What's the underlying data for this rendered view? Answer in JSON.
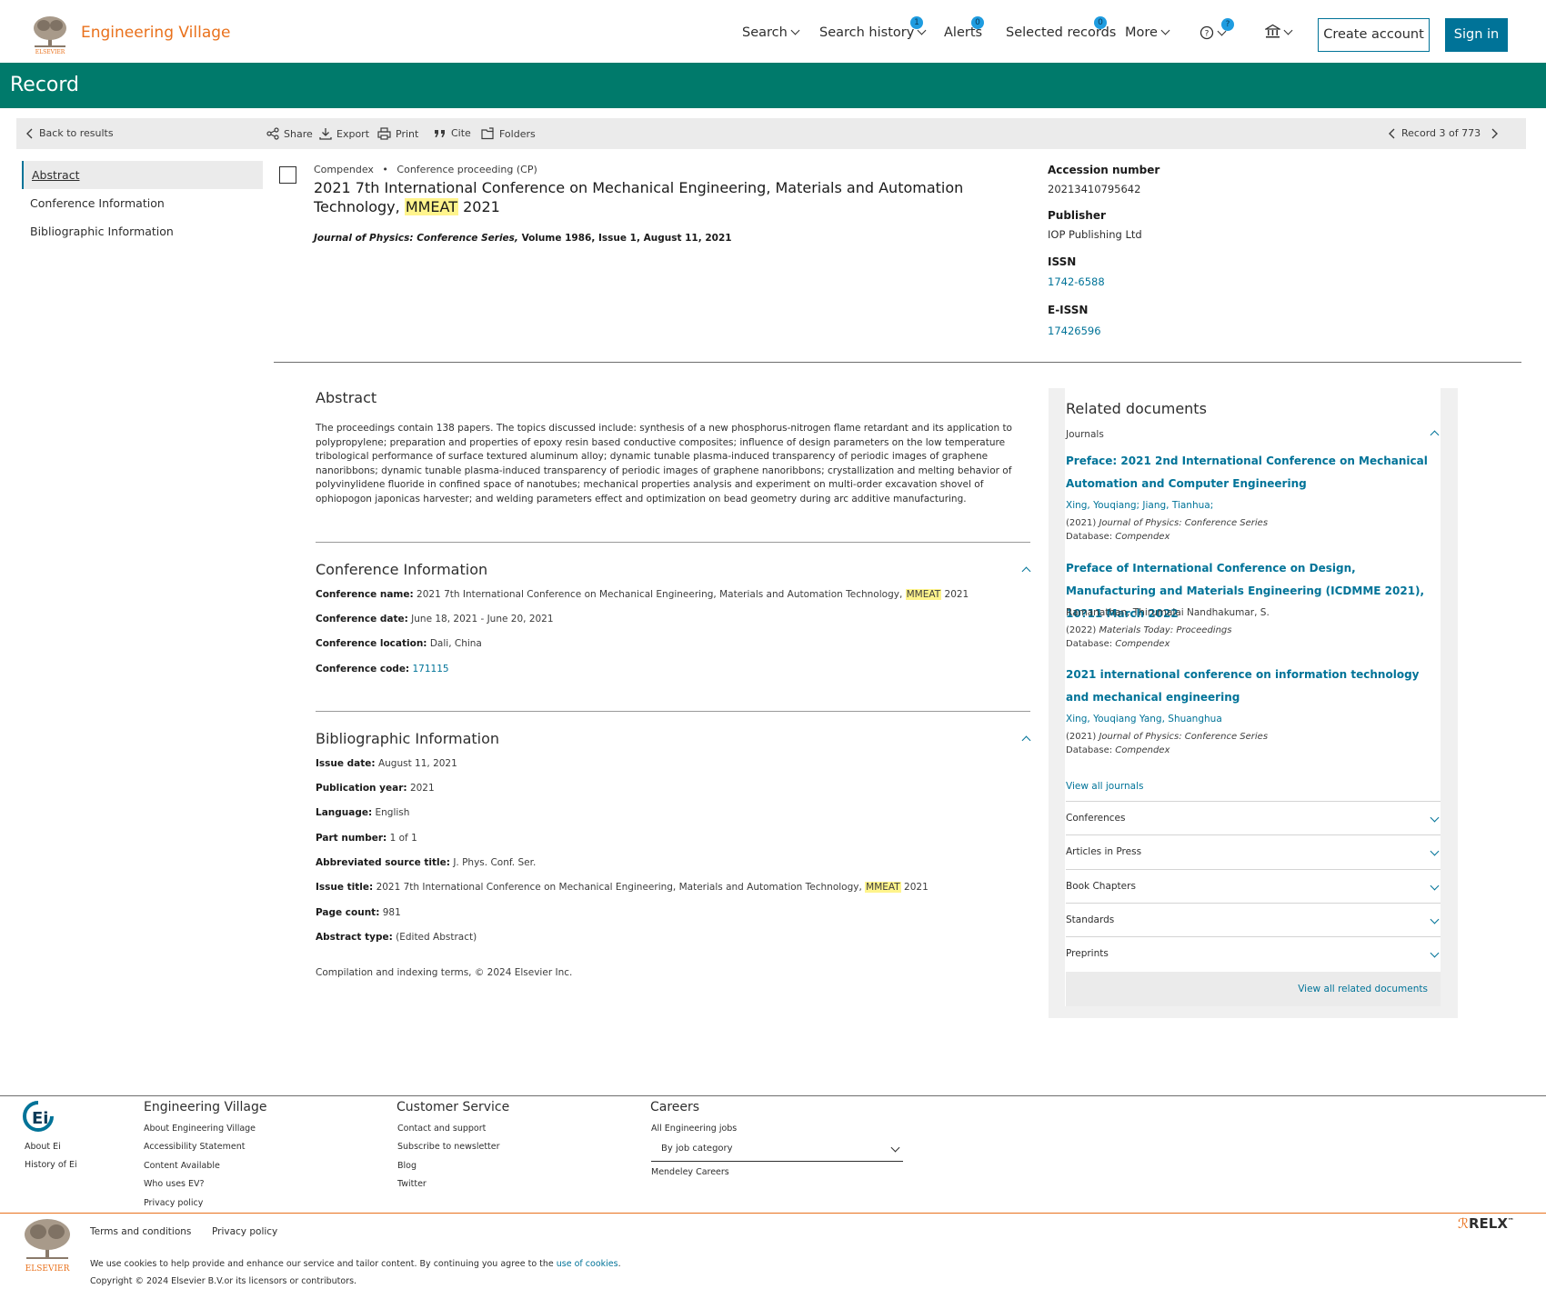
{
  "header": {
    "brand": "Engineering Village",
    "nav": [
      {
        "label": "Search",
        "badge": ""
      },
      {
        "label": "Search history",
        "badge": "1"
      },
      {
        "label": "Alerts",
        "badge": "0"
      },
      {
        "label": "Selected records",
        "badge": "0"
      },
      {
        "label": "More",
        "badge": ""
      }
    ],
    "help_badge": "?",
    "create_account": "Create account",
    "sign_in": "Sign in"
  },
  "band": {
    "title": "Record"
  },
  "toolbar": {
    "back": "Back to results",
    "share": "Share",
    "export": "Export",
    "print": "Print",
    "cite": "Cite",
    "folders": "Folders",
    "record_nav": "Record 3 of 773"
  },
  "left_nav": [
    "Abstract",
    "Conference Information",
    "Bibliographic Information"
  ],
  "record": {
    "database": "Compendex",
    "doc_type": "Conference proceeding (CP)",
    "title_pre": "2021 7th International Conference on Mechanical Engineering, Materials and Automation Technology,",
    "title_mark": "MMEAT",
    "title_post": "2021",
    "source_journal": "Journal of Physics: Conference Series,",
    "source_rest": "Volume 1986, Issue 1, August 11, 2021"
  },
  "right_meta": [
    {
      "label": "Accession number",
      "value": "20213410795642",
      "link": false
    },
    {
      "label": "Publisher",
      "value": "IOP Publishing Ltd",
      "link": false
    },
    {
      "label": "ISSN",
      "value": "1742-6588",
      "link": true
    },
    {
      "label": "E-ISSN",
      "value": "17426596",
      "link": true
    }
  ],
  "abstract": {
    "heading": "Abstract",
    "text": "The proceedings contain 138 papers. The topics discussed include: synthesis of a new phosphorus-nitrogen flame retardant and its application to polypropylene; preparation and properties of epoxy resin based conductive composites; influence of design parameters on the low temperature tribological performance of surface textured aluminum alloy; dynamic tunable plasma-induced transparency of periodic images of graphene nanoribbons; dynamic tunable plasma-induced transparency of periodic images of graphene nanoribbons; crystallization and melting behavior of polyvinylidene fluoride in confined space of nanotubes; mechanical properties analysis and experiment on multi-order excavation shovel of ophiopogon japonicas harvester; and welding parameters effect and optimization on bead geometry during arc additive manufacturing."
  },
  "conference": {
    "heading": "Conference Information",
    "name_label": "Conference name:",
    "name_pre": "2021 7th International Conference on Mechanical Engineering, Materials and Automation Technology,",
    "name_mark": "MMEAT",
    "name_post": "2021",
    "date_label": "Conference date:",
    "date": "June 18, 2021 - June 20, 2021",
    "location_label": "Conference location:",
    "location": "Dali, China",
    "code_label": "Conference code:",
    "code": "171115"
  },
  "biblio": {
    "heading": "Bibliographic Information",
    "fields": [
      {
        "label": "Issue date:",
        "value": "August 11, 2021"
      },
      {
        "label": "Publication year:",
        "value": "2021"
      },
      {
        "label": "Language:",
        "value": "English"
      },
      {
        "label": "Part number:",
        "value": "1 of 1"
      },
      {
        "label": "Abbreviated source title:",
        "value": "J. Phys. Conf. Ser."
      }
    ],
    "issue_title_label": "Issue title:",
    "issue_title_pre": "2021 7th International Conference on Mechanical Engineering, Materials and Automation Technology,",
    "issue_title_mark": "MMEAT",
    "issue_title_post": "2021",
    "page_count_label": "Page count:",
    "page_count": "981",
    "abstract_type_label": "Abstract type:",
    "abstract_type": "(Edited Abstract)",
    "copyright": "Compilation and indexing terms, © 2024 Elsevier Inc."
  },
  "related": {
    "heading": "Related documents",
    "journals_label": "Journals",
    "docs": [
      {
        "title": "Preface: 2021 2nd International Conference on Mechanical Automation and Computer Engineering",
        "authors": "Xing, Youqiang; Jiang, Tianhua;",
        "year": "(2021)",
        "journal": "Journal of Physics: Conference Series",
        "db_label": "Database:",
        "db": "Compendex"
      },
      {
        "title": "Preface of International Conference on Design, Manufacturing and Materials Engineering (ICDMME 2021), 10?11 March 2022",
        "authors": "Ramanathan, Thirumalai Nandhakumar, S.",
        "year": "(2022)",
        "journal": "Materials Today: Proceedings",
        "db_label": "Database:",
        "db": "Compendex"
      },
      {
        "title": "2021 international conference on information technology and mechanical engineering",
        "authors": "Xing, Youqiang Yang, Shuanghua",
        "year": "(2021)",
        "journal": "Journal of Physics: Conference Series",
        "db_label": "Database:",
        "db": "Compendex"
      }
    ],
    "view_all_journals": "View all journals",
    "categories": [
      "Conferences",
      "Articles in Press",
      "Book Chapters",
      "Standards",
      "Preprints"
    ],
    "view_all": "View all related documents"
  },
  "footer": {
    "about_ei": "About Ei",
    "history_ei": "History of Ei",
    "ev_heading": "Engineering Village",
    "ev_links": [
      "About Engineering Village",
      "Accessibility Statement",
      "Content Available",
      "Who uses EV?",
      "Privacy policy"
    ],
    "cs_heading": "Customer Service",
    "cs_links": [
      "Contact and support",
      "Subscribe to newsletter",
      "Blog",
      "Twitter"
    ],
    "careers_heading": "Careers",
    "careers_all": "All Engineering jobs",
    "careers_select": "By job category",
    "careers_mendeley": "Mendeley Careers",
    "terms": "Terms and conditions",
    "privacy": "Privacy policy",
    "cookies_text": "We use cookies to help provide and enhance our service and tailor content. By continuing you agree to the",
    "cookies_link": "use of cookies",
    "copyright": "Copyright © 2024 Elsevier B.V.or its licensors or contributors.",
    "elsevier": "ELSEVIER",
    "relx": "RELX",
    "tm": "™",
    "ei_logo": "Ei"
  },
  "colors": {
    "brand_orange": "#e9711c",
    "band_green": "#007a6b",
    "link_blue": "#007398",
    "highlight": "#fff48c",
    "badge_blue": "#1e9ce0"
  }
}
